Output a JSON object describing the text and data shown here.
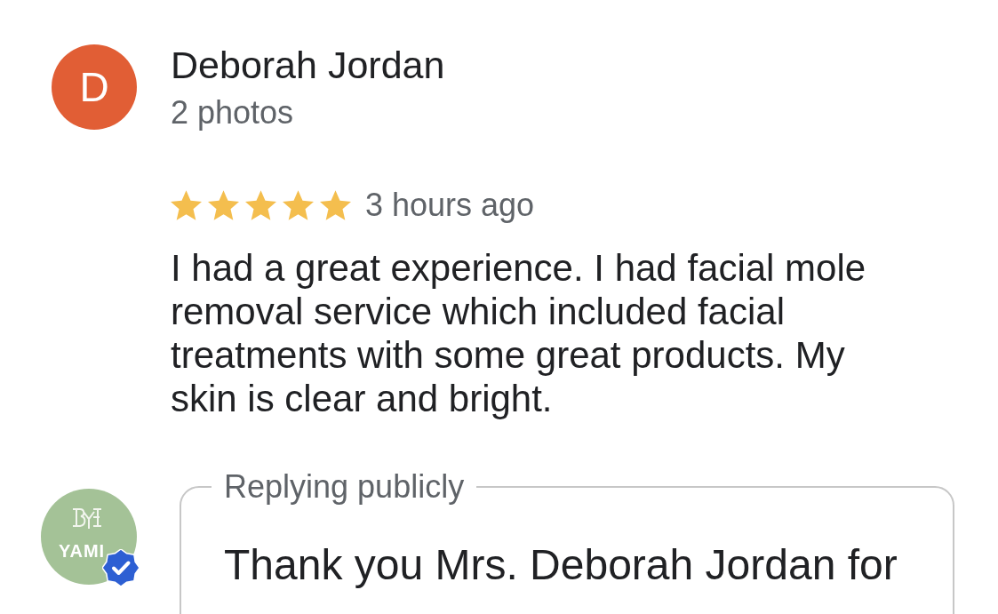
{
  "review": {
    "author": {
      "initial": "D",
      "name": "Deborah Jordan",
      "photos": "2 photos"
    },
    "stars": 5,
    "time": "3 hours ago",
    "text": "I had a great experience. I had facial mole removal service which included facial treatments with some great products. My skin is clear and bright."
  },
  "reply": {
    "legend": "Replying publicly",
    "logo_text": "YAMI",
    "verified": true,
    "text": "Thank you Mrs. Deborah Jordan for"
  }
}
